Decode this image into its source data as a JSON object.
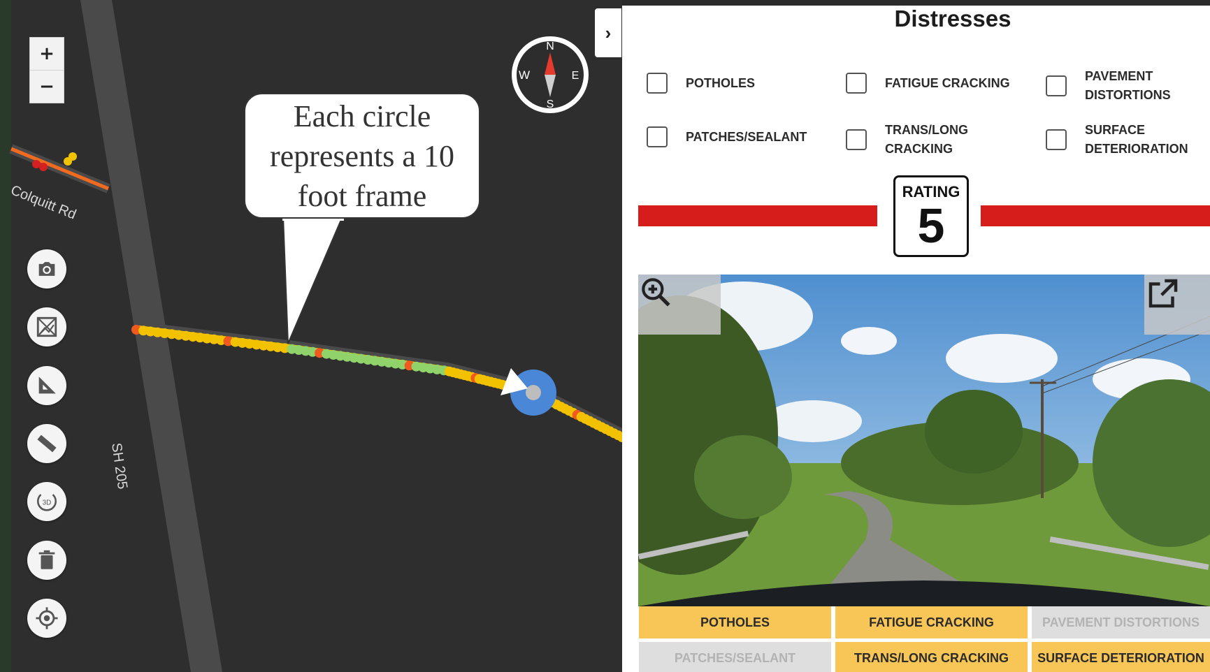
{
  "map": {
    "zoom_in": "+",
    "zoom_out": "−",
    "road_labels": [
      "Colquitt Rd",
      "SH 205"
    ],
    "compass": {
      "n": "N",
      "s": "S",
      "e": "E",
      "w": "W"
    },
    "tooltip": "Each circle represents a 10 foot frame",
    "tools": [
      "camera-icon",
      "image-off-icon",
      "area-measure-icon",
      "ruler-icon",
      "3d-rotate-icon",
      "trash-icon",
      "locate-icon"
    ],
    "tool_3d_text": "3D",
    "collapse": "›"
  },
  "panel": {
    "title": "Distresses",
    "checkboxes": [
      {
        "label": "POTHOLES",
        "checked": false
      },
      {
        "label": "FATIGUE CRACKING",
        "checked": false
      },
      {
        "label": "PAVEMENT DISTORTIONS",
        "checked": false
      },
      {
        "label": "PATCHES/SEALANT",
        "checked": false
      },
      {
        "label": "TRANS/LONG CRACKING",
        "checked": false
      },
      {
        "label": "SURFACE DETERIORATION",
        "checked": false
      }
    ],
    "rating_label": "RATING",
    "rating_value": "5",
    "tags": [
      {
        "label": "POTHOLES",
        "active": true
      },
      {
        "label": "FATIGUE CRACKING",
        "active": true
      },
      {
        "label": "PAVEMENT DISTORTIONS",
        "active": false
      },
      {
        "label": "PATCHES/SEALANT",
        "active": false
      },
      {
        "label": "TRANS/LONG CRACKING",
        "active": true
      },
      {
        "label": "SURFACE DETERIORATION",
        "active": true
      }
    ]
  },
  "colors": {
    "rating_bar": "#d71c1c",
    "tag_active": "#f8c657",
    "tag_inactive": "#dedede",
    "map_bg": "#2e2e2e"
  }
}
